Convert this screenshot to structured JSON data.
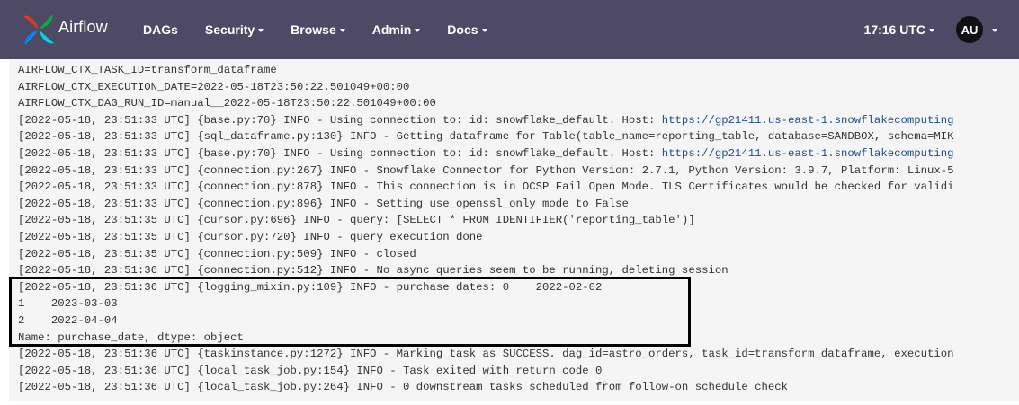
{
  "app": {
    "brand": "Airflow",
    "colors": {
      "navbar": "#4e4a66",
      "log_background": "#f5f5f5",
      "link": "#1f4e8c",
      "highlight_border": "#000000"
    }
  },
  "nav": {
    "items": [
      {
        "label": "DAGs",
        "dropdown": false
      },
      {
        "label": "Security",
        "dropdown": true
      },
      {
        "label": "Browse",
        "dropdown": true
      },
      {
        "label": "Admin",
        "dropdown": true
      },
      {
        "label": "Docs",
        "dropdown": true
      }
    ],
    "clock": "17:16 UTC",
    "user_initials": "AU"
  },
  "log": {
    "lines": [
      {
        "text": "AIRFLOW_CTX_TASK_ID=transform_dataframe"
      },
      {
        "text": "AIRFLOW_CTX_EXECUTION_DATE=2022-05-18T23:50:22.501049+00:00"
      },
      {
        "text": "AIRFLOW_CTX_DAG_RUN_ID=manual__2022-05-18T23:50:22.501049+00:00"
      },
      {
        "text": "[2022-05-18, 23:51:33 UTC] {base.py:70} INFO - Using connection to: id: snowflake_default. Host: ",
        "link": "https://gp21411.us-east-1.snowflakecomputing"
      },
      {
        "text": "[2022-05-18, 23:51:33 UTC] {sql_dataframe.py:130} INFO - Getting dataframe for Table(table_name=reporting_table, database=SANDBOX, schema=MIK"
      },
      {
        "text": "[2022-05-18, 23:51:33 UTC] {base.py:70} INFO - Using connection to: id: snowflake_default. Host: ",
        "link": "https://gp21411.us-east-1.snowflakecomputing"
      },
      {
        "text": "[2022-05-18, 23:51:33 UTC] {connection.py:267} INFO - Snowflake Connector for Python Version: 2.7.1, Python Version: 3.9.7, Platform: Linux-5"
      },
      {
        "text": "[2022-05-18, 23:51:33 UTC] {connection.py:878} INFO - This connection is in OCSP Fail Open Mode. TLS Certificates would be checked for validi"
      },
      {
        "text": "[2022-05-18, 23:51:33 UTC] {connection.py:896} INFO - Setting use_openssl_only mode to False"
      },
      {
        "text": "[2022-05-18, 23:51:35 UTC] {cursor.py:696} INFO - query: [SELECT * FROM IDENTIFIER('reporting_table')]"
      },
      {
        "text": "[2022-05-18, 23:51:35 UTC] {cursor.py:720} INFO - query execution done"
      },
      {
        "text": "[2022-05-18, 23:51:35 UTC] {connection.py:509} INFO - closed"
      },
      {
        "text": "[2022-05-18, 23:51:36 UTC] {connection.py:512} INFO - No async queries seem to be running, deleting session"
      },
      {
        "text": "[2022-05-18, 23:51:36 UTC] {logging_mixin.py:109} INFO - purchase dates: 0    2022-02-02"
      },
      {
        "text": "1    2023-03-03"
      },
      {
        "text": "2    2022-04-04"
      },
      {
        "text": "Name: purchase_date, dtype: object"
      },
      {
        "text": "[2022-05-18, 23:51:36 UTC] {taskinstance.py:1272} INFO - Marking task as SUCCESS. dag_id=astro_orders, task_id=transform_dataframe, execution"
      },
      {
        "text": "[2022-05-18, 23:51:36 UTC] {local_task_job.py:154} INFO - Task exited with return code 0"
      },
      {
        "text": "[2022-05-18, 23:51:36 UTC] {local_task_job.py:264} INFO - 0 downstream tasks scheduled from follow-on schedule check"
      }
    ]
  }
}
